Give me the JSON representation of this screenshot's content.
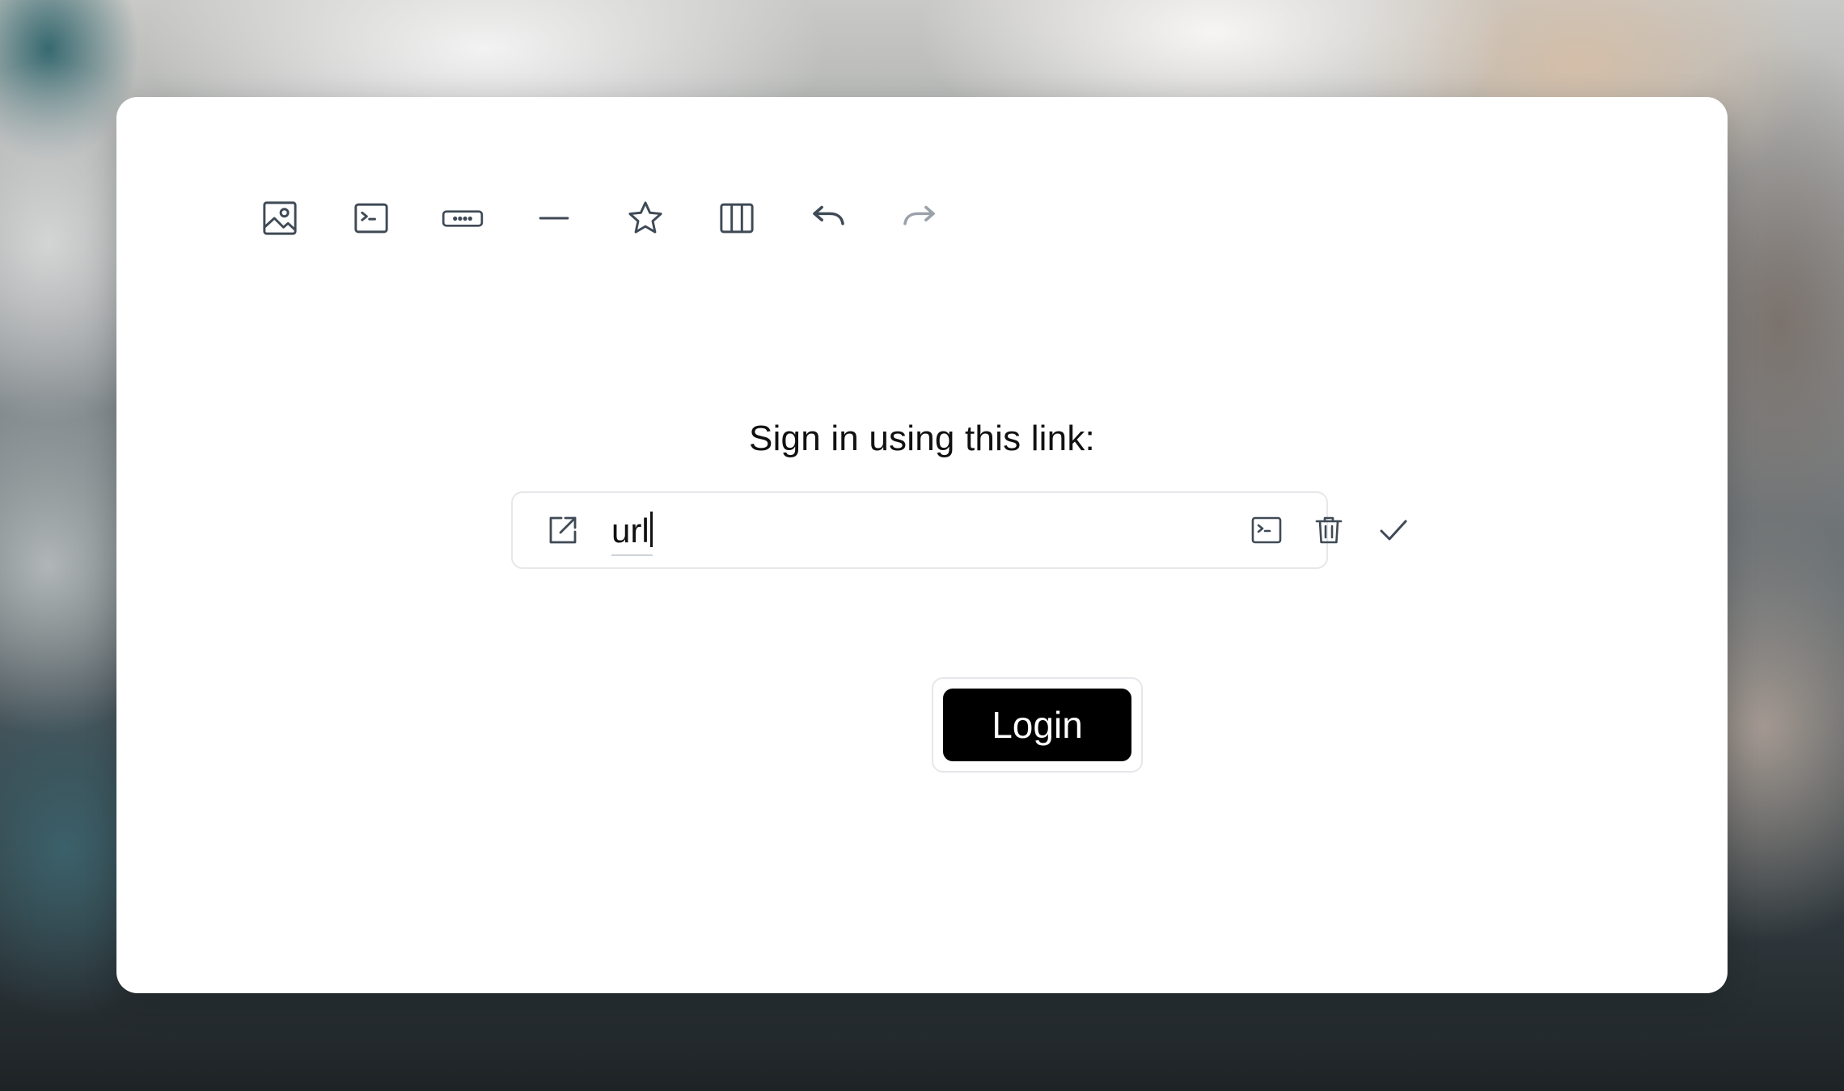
{
  "toolbar": {
    "items": [
      {
        "name": "image-icon"
      },
      {
        "name": "code-block-icon"
      },
      {
        "name": "button-icon"
      },
      {
        "name": "horizontal-rule-icon"
      },
      {
        "name": "star-icon"
      },
      {
        "name": "columns-icon"
      },
      {
        "name": "undo-icon"
      },
      {
        "name": "redo-icon",
        "disabled": true
      }
    ]
  },
  "content": {
    "signin_label": "Sign in using this link:",
    "url_value": "url",
    "login_label": "Login"
  },
  "link_bar": {
    "icons": [
      "open-link-icon",
      "code-icon",
      "trash-icon",
      "check-icon"
    ]
  },
  "colors": {
    "icon": "#3f4a56",
    "icon_disabled": "#9aa1a9",
    "button_bg": "#000000",
    "button_text": "#ffffff",
    "border": "#e6e7ea"
  }
}
